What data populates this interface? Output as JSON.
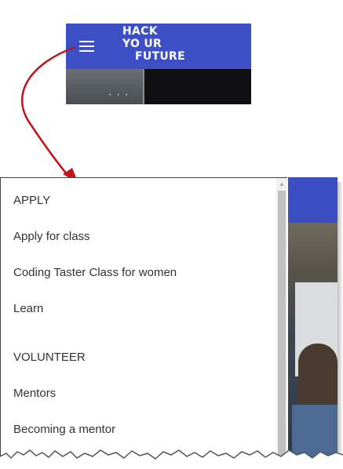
{
  "logo": {
    "line1": "HACK",
    "line2": "YO UR",
    "line3": "FUTURE"
  },
  "colors": {
    "brand_blue": "#3d4fc4",
    "arrow": "#c0141a",
    "text": "#333333"
  },
  "menu": {
    "items": [
      {
        "label": "APPLY",
        "type": "section"
      },
      {
        "label": "Apply for class",
        "type": "link"
      },
      {
        "label": "Coding Taster Class for women",
        "type": "link"
      },
      {
        "label": "Learn",
        "type": "link"
      },
      {
        "label": "VOLUNTEER",
        "type": "section"
      },
      {
        "label": "Mentors",
        "type": "link"
      },
      {
        "label": "Becoming a mentor",
        "type": "link"
      }
    ]
  },
  "icons": {
    "menu": "hamburger-menu-icon",
    "scroll_up": "scroll-up-arrow-icon",
    "callout": "curved-arrow-icon"
  }
}
